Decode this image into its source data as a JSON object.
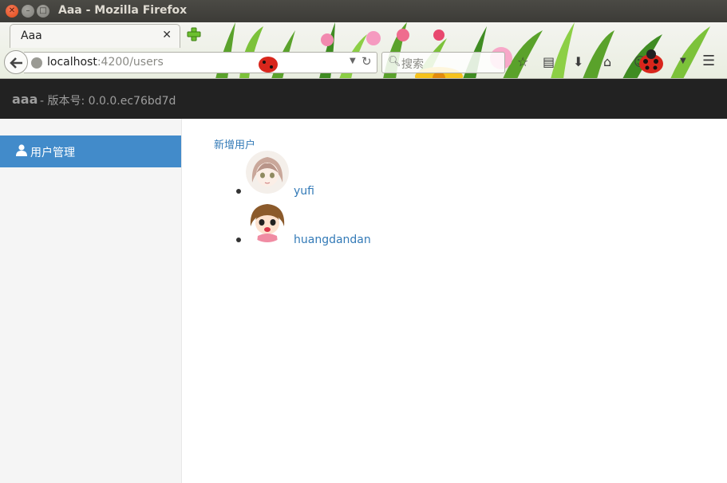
{
  "window": {
    "title": "Aaa - Mozilla Firefox"
  },
  "browser": {
    "tab_title": "Aaa",
    "url_host": "localhost",
    "url_path": ":4200/users",
    "search_placeholder": "搜索"
  },
  "app": {
    "brand": "aaa",
    "version": "- 版本号: 0.0.0.ec76bd7d"
  },
  "sidebar": {
    "items": [
      {
        "label": "用户管理",
        "icon": "user-icon",
        "active": true
      }
    ]
  },
  "main": {
    "add_user_link": "新增用户",
    "users": [
      {
        "name": "yufi",
        "avatar": "avatar-girl-light-hair"
      },
      {
        "name": "huangdandan",
        "avatar": "avatar-girl-brown-hair"
      }
    ]
  },
  "colors": {
    "header_bg": "#222222",
    "sidebar_active": "#428bca",
    "link": "#337ab7"
  }
}
